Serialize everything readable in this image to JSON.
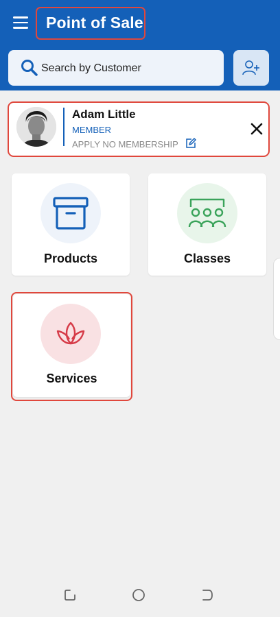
{
  "header": {
    "title": "Point of Sale"
  },
  "search": {
    "placeholder": "Search by Customer"
  },
  "member": {
    "name": "Adam Little",
    "type": "MEMBER",
    "apply_label": "APPLY NO MEMBERSHIP"
  },
  "tiles": [
    {
      "label": "Products",
      "icon": "archive-box-icon"
    },
    {
      "label": "Classes",
      "icon": "group-class-icon"
    },
    {
      "label": "Services",
      "icon": "lotus-icon"
    }
  ],
  "colors": {
    "brand": "#1460b8",
    "highlight": "#e0473c",
    "products": "#1460b8",
    "classes": "#3aa35a",
    "services": "#d63b48"
  }
}
